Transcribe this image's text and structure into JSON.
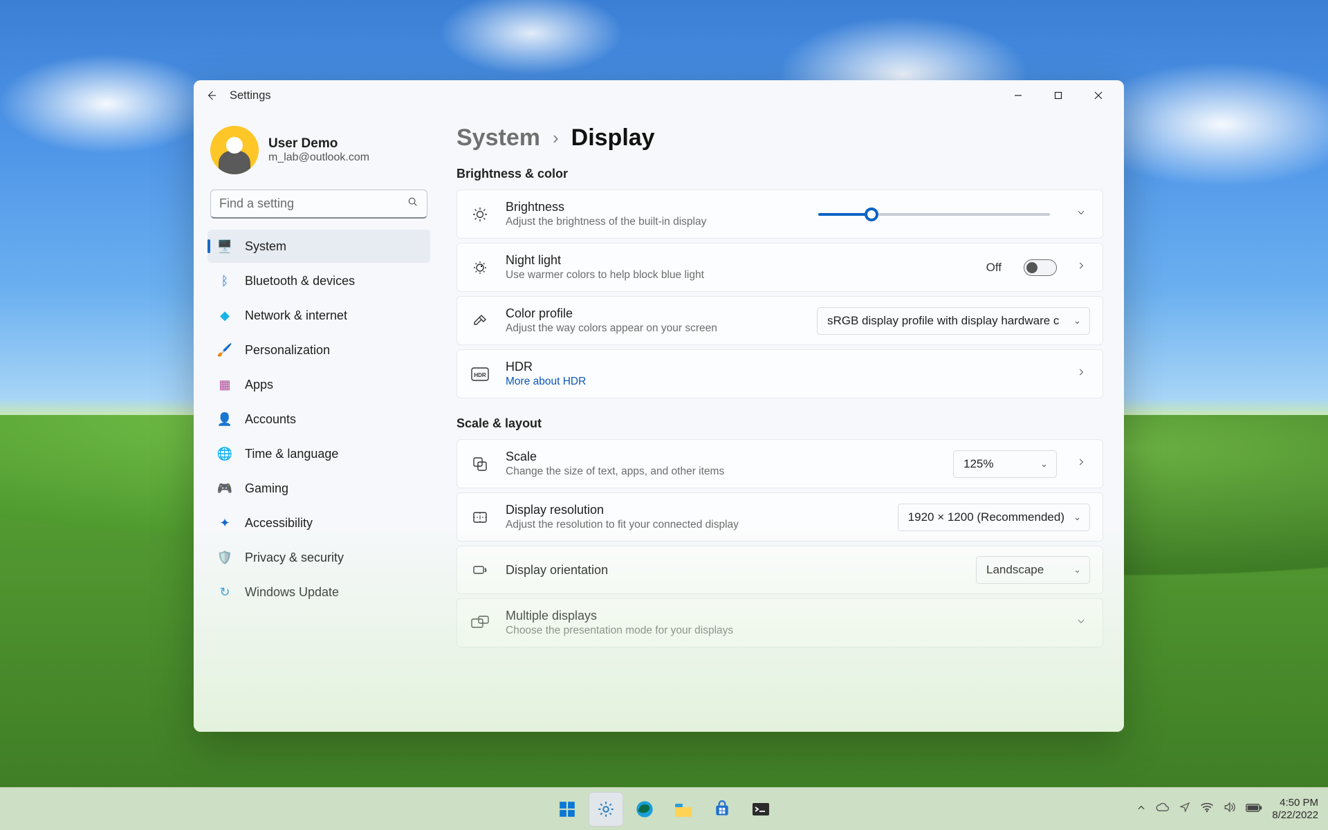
{
  "window": {
    "title": "Settings",
    "account": {
      "name": "User Demo",
      "email": "m_lab@outlook.com"
    },
    "search_placeholder": "Find a setting"
  },
  "sidebar": {
    "items": [
      {
        "label": "System",
        "icon": "🖥️",
        "selected": true
      },
      {
        "label": "Bluetooth & devices",
        "icon": "ᛒ",
        "color": "#1f6fd0"
      },
      {
        "label": "Network & internet",
        "icon": "◆",
        "color": "#18b4e6"
      },
      {
        "label": "Personalization",
        "icon": "🖌️"
      },
      {
        "label": "Apps",
        "icon": "▦",
        "color": "#b14b9b"
      },
      {
        "label": "Accounts",
        "icon": "👤",
        "color": "#17a558"
      },
      {
        "label": "Time & language",
        "icon": "🌐"
      },
      {
        "label": "Gaming",
        "icon": "🎮",
        "color": "#777"
      },
      {
        "label": "Accessibility",
        "icon": "✦",
        "color": "#1769c6"
      },
      {
        "label": "Privacy & security",
        "icon": "🛡️",
        "color": "#8a8f96"
      },
      {
        "label": "Windows Update",
        "icon": "↻",
        "color": "#1f8ed0"
      }
    ]
  },
  "breadcrumb": {
    "root": "System",
    "leaf": "Display"
  },
  "sections": {
    "brightness_color": {
      "title": "Brightness & color",
      "brightness": {
        "title": "Brightness",
        "sub": "Adjust the brightness of the built-in display",
        "value_pct": 23
      },
      "night_light": {
        "title": "Night light",
        "sub": "Use warmer colors to help block blue light",
        "state_label": "Off",
        "on": false
      },
      "color_profile": {
        "title": "Color profile",
        "sub": "Adjust the way colors appear on your screen",
        "value": "sRGB display profile with display hardware c"
      },
      "hdr": {
        "title": "HDR",
        "link": "More about HDR"
      }
    },
    "scale_layout": {
      "title": "Scale & layout",
      "scale": {
        "title": "Scale",
        "sub": "Change the size of text, apps, and other items",
        "value": "125%"
      },
      "resolution": {
        "title": "Display resolution",
        "sub": "Adjust the resolution to fit your connected display",
        "value": "1920 × 1200 (Recommended)"
      },
      "orientation": {
        "title": "Display orientation",
        "value": "Landscape"
      },
      "multiple": {
        "title": "Multiple displays",
        "sub": "Choose the presentation mode for your displays"
      }
    }
  },
  "taskbar": {
    "time": "4:50 PM",
    "date": "8/22/2022"
  }
}
